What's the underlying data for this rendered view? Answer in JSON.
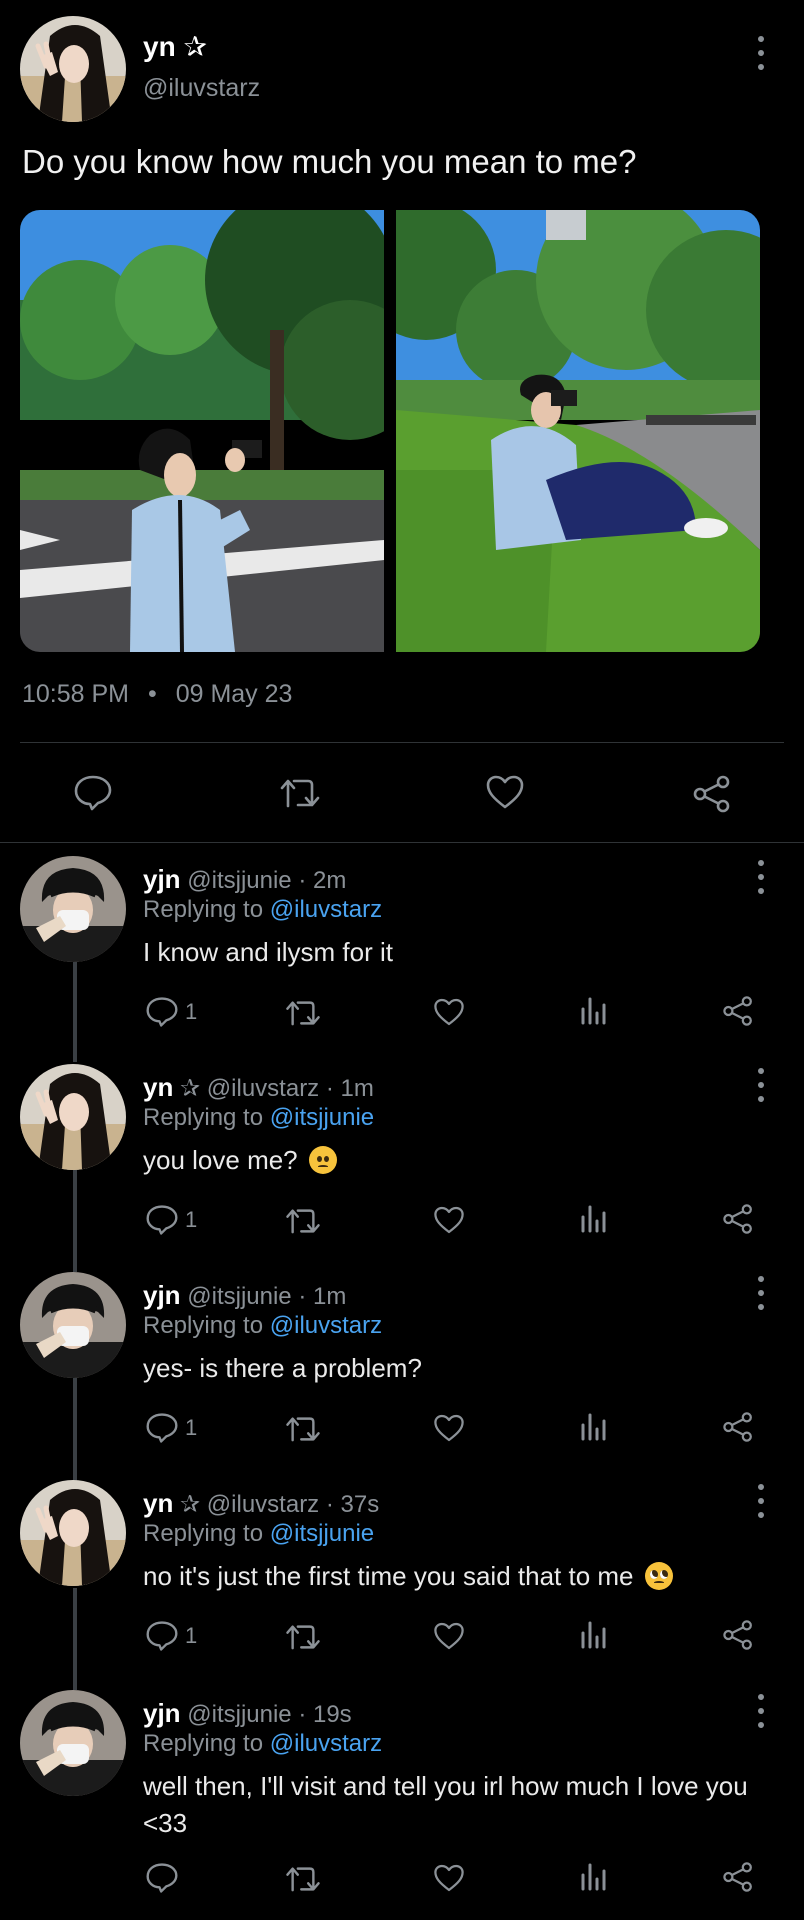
{
  "main_tweet": {
    "name": "yn",
    "badge": "✰",
    "handle": "@iluvstarz",
    "text": "Do you know how much you mean to me?",
    "time": "10:58 PM",
    "separator": "•",
    "date": "09 May 23"
  },
  "icons": {
    "reply": "comment-icon",
    "retweet": "retweet-icon",
    "like": "heart-icon",
    "share": "share-icon",
    "views": "analytics-icon",
    "more": "more-vertical-icon"
  },
  "replies": [
    {
      "name": "yjn",
      "badge": "",
      "handle": "@itsjjunie",
      "age": "· 2m",
      "replying_label": "Replying to",
      "replying_to": "@iluvstarz",
      "text": "I know and ilysm for it",
      "emoji": "",
      "reply_count": "1"
    },
    {
      "name": "yn",
      "badge": "✰",
      "handle": "@iluvstarz",
      "age": "· 1m",
      "replying_label": "Replying to",
      "replying_to": "@itsjjunie",
      "text": "you love me?",
      "emoji": "worried-face",
      "reply_count": "1"
    },
    {
      "name": "yjn",
      "badge": "",
      "handle": "@itsjjunie",
      "age": "· 1m",
      "replying_label": "Replying to",
      "replying_to": "@iluvstarz",
      "text": "yes- is there a problem?",
      "emoji": "",
      "reply_count": "1"
    },
    {
      "name": "yn",
      "badge": "✰",
      "handle": "@iluvstarz",
      "age": "· 37s",
      "replying_label": "Replying to",
      "replying_to": "@itsjjunie",
      "text": "no it's just the first time you said that to me",
      "emoji": "pleading-face",
      "reply_count": "1"
    },
    {
      "name": "yjn",
      "badge": "",
      "handle": "@itsjjunie",
      "age": "· 19s",
      "replying_label": "Replying to",
      "replying_to": "@iluvstarz",
      "text": "well then, I'll visit and tell you irl how much I love you <33",
      "emoji": "",
      "reply_count": ""
    }
  ],
  "colors": {
    "background": "#000000",
    "mention": "#4aa3f0",
    "muted": "#8b9197"
  }
}
